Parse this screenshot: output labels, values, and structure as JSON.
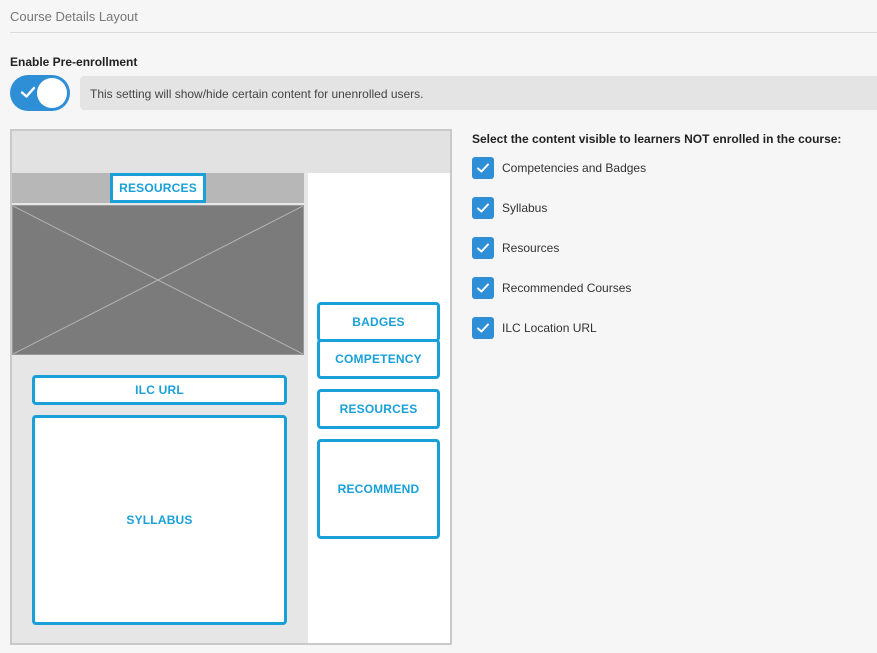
{
  "section": {
    "title": "Course Details Layout"
  },
  "preenrollment": {
    "label": "Enable Pre-enrollment",
    "toggle_on": true,
    "info": "This setting will show/hide certain content for unenrolled users."
  },
  "wireframe": {
    "tab_resources": "RESOURCES",
    "ilc_url": "ILC URL",
    "syllabus": "SYLLABUS",
    "badges": "BADGES",
    "competency": "COMPETENCY",
    "resources": "RESOURCES",
    "recommend": "RECOMMEND"
  },
  "visibility": {
    "label": "Select the content visible to learners NOT enrolled in the course:",
    "items": [
      {
        "label": "Competencies and Badges",
        "checked": true
      },
      {
        "label": "Syllabus",
        "checked": true
      },
      {
        "label": "Resources",
        "checked": true
      },
      {
        "label": "Recommended Courses",
        "checked": true
      },
      {
        "label": "ILC Location URL",
        "checked": true
      }
    ]
  },
  "colors": {
    "accent": "#2f8fd6",
    "wire_accent": "#1aa0d8"
  },
  "icons": {
    "toggle": "check-icon",
    "checkbox": "check-icon",
    "placeholder": "image-placeholder-icon"
  }
}
